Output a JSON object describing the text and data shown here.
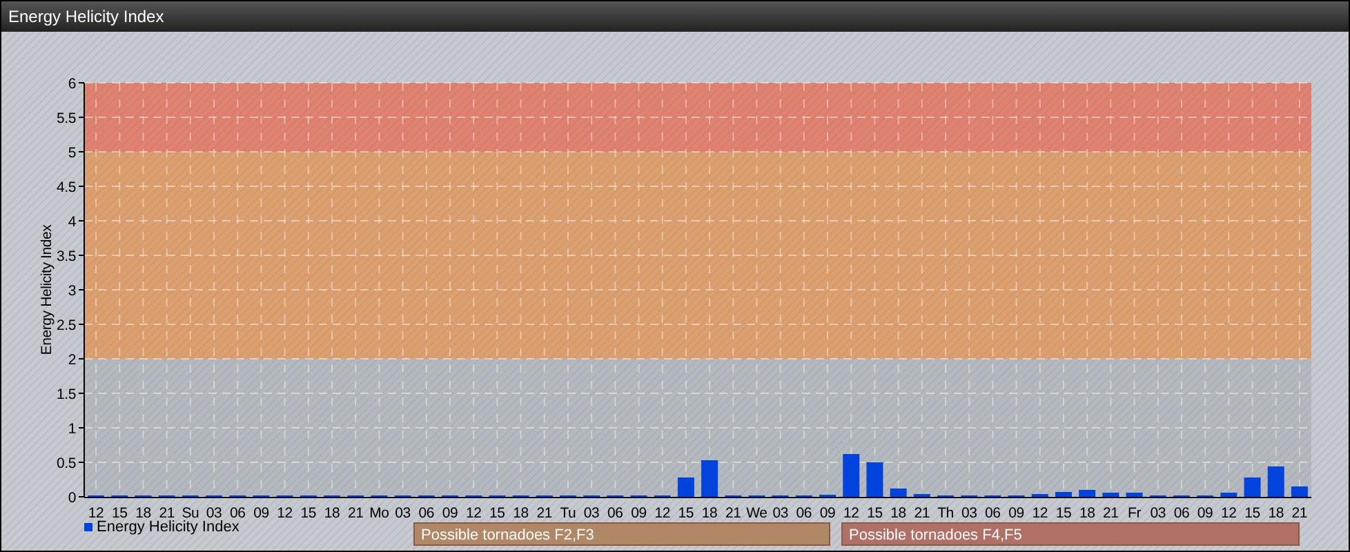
{
  "window": {
    "title": "Energy Helicity Index"
  },
  "chart": {
    "chart_data": {
      "type": "bar",
      "ylabel": "Energy Helicity Index",
      "ylim": [
        0,
        6
      ],
      "yticks": [
        0,
        0.5,
        1,
        1.5,
        2,
        2.5,
        3,
        3.5,
        4,
        4.5,
        5,
        5.5,
        6
      ],
      "categories": [
        "12",
        "15",
        "18",
        "21",
        "Su",
        "03",
        "06",
        "09",
        "12",
        "15",
        "18",
        "21",
        "Mo",
        "03",
        "06",
        "09",
        "12",
        "15",
        "18",
        "21",
        "Tu",
        "03",
        "06",
        "09",
        "12",
        "15",
        "18",
        "21",
        "We",
        "03",
        "06",
        "09",
        "12",
        "15",
        "18",
        "21",
        "Th",
        "03",
        "06",
        "09",
        "12",
        "15",
        "18",
        "21",
        "Fr",
        "03",
        "06",
        "09",
        "12",
        "15",
        "18",
        "21"
      ],
      "series": [
        {
          "name": "Energy Helicity Index",
          "color": "#0044dd",
          "values": [
            0.02,
            0.02,
            0.02,
            0.02,
            0.02,
            0.02,
            0.02,
            0.02,
            0.02,
            0.02,
            0.02,
            0.02,
            0.02,
            0.02,
            0.02,
            0.02,
            0.02,
            0.02,
            0.02,
            0.02,
            0.02,
            0.02,
            0.02,
            0.02,
            0.02,
            0.28,
            0.53,
            0.02,
            0.02,
            0.02,
            0.02,
            0.03,
            0.62,
            0.5,
            0.12,
            0.04,
            0.02,
            0.02,
            0.02,
            0.02,
            0.04,
            0.07,
            0.1,
            0.06,
            0.06,
            0.02,
            0.02,
            0.02,
            0.06,
            0.28,
            0.44,
            0.15
          ]
        }
      ],
      "grid": true,
      "bands": [
        {
          "axis": "y",
          "from": 2,
          "to": 5,
          "color": "#dca070"
        },
        {
          "axis": "y",
          "from": 5,
          "to": 6,
          "color": "#e08272"
        }
      ]
    },
    "zones": [
      {
        "label": "Possible tornadoes F2,F3",
        "color": "#b08866"
      },
      {
        "label": "Possible tornadoes F4,F5",
        "color": "#b07066"
      }
    ]
  }
}
